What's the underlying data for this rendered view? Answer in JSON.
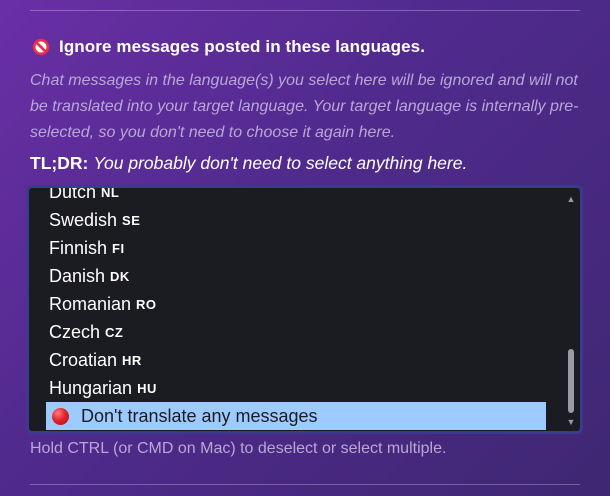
{
  "section": {
    "heading": "Ignore messages posted in these languages.",
    "icon": "ban-icon",
    "description": "Chat messages in the language(s) you select here will be ignored and will not be translated into your target language. Your target language is internally pre-selected, so you don't need to choose it again here.",
    "tldr_label": "TL;DR:",
    "tldr_text": "You probably don't need to select anything here."
  },
  "language_list": {
    "options": [
      {
        "name": "Dutch",
        "code": "NL"
      },
      {
        "name": "Swedish",
        "code": "SE"
      },
      {
        "name": "Finnish",
        "code": "FI"
      },
      {
        "name": "Danish",
        "code": "DK"
      },
      {
        "name": "Romanian",
        "code": "RO"
      },
      {
        "name": "Czech",
        "code": "CZ"
      },
      {
        "name": "Croatian",
        "code": "HR"
      },
      {
        "name": "Hungarian",
        "code": "HU"
      }
    ],
    "selected_option": {
      "label": "Don't translate any messages",
      "icon": "red-circle-icon"
    }
  },
  "hint": "Hold CTRL (or CMD on Mac) to deselect or select multiple.",
  "colors": {
    "accent_selected": "#9ecbff",
    "listbox_bg": "#1b1b22",
    "listbox_border": "#3b3a8e",
    "muted_text": "#b9a7d6"
  }
}
